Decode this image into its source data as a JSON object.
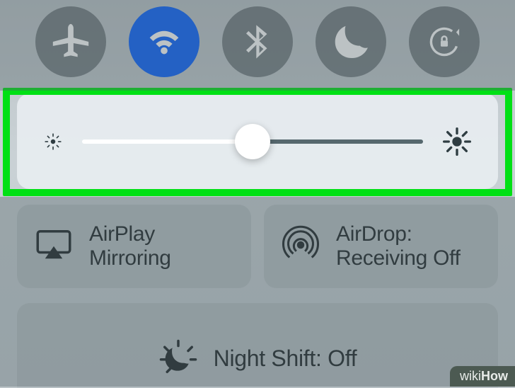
{
  "toggles": {
    "airplane": {
      "name": "airplane-mode",
      "active": false
    },
    "wifi": {
      "name": "wifi",
      "active": true
    },
    "bluetooth": {
      "name": "bluetooth",
      "active": false
    },
    "dnd": {
      "name": "do-not-disturb",
      "active": false
    },
    "lock": {
      "name": "rotation-lock",
      "active": false
    }
  },
  "brightness": {
    "percent": 50
  },
  "share": {
    "airplay": {
      "line1": "AirPlay",
      "line2": "Mirroring"
    },
    "airdrop": {
      "line1": "AirDrop:",
      "line2": "Receiving Off"
    }
  },
  "nightshift": {
    "label": "Night Shift: Off"
  },
  "watermark": "wikiHow"
}
